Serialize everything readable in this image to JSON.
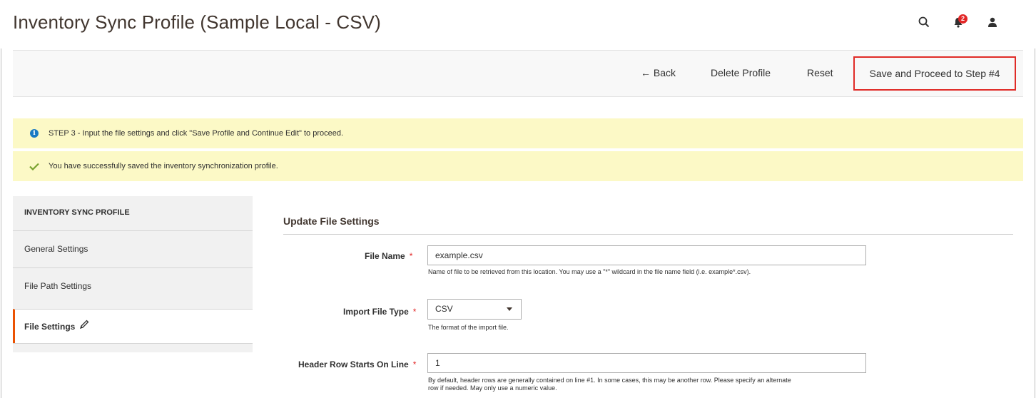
{
  "header": {
    "title": "Inventory Sync Profile (Sample Local - CSV)",
    "notification_count": "2"
  },
  "actions": {
    "back_label": "← Back",
    "delete_label": "Delete Profile",
    "reset_label": "Reset",
    "save_label": "Save and Proceed to Step #4"
  },
  "messages": {
    "info": "STEP 3 - Input the file settings and click \"Save Profile and Continue Edit\" to proceed.",
    "success": "You have successfully saved the inventory synchronization profile."
  },
  "sidebar": {
    "title": "INVENTORY SYNC PROFILE",
    "items": [
      {
        "label": "General Settings"
      },
      {
        "label": "File Path Settings"
      },
      {
        "label": "File Settings",
        "active": true
      }
    ]
  },
  "form": {
    "section_title": "Update File Settings",
    "file_name": {
      "label": "File Name",
      "value": "example.csv",
      "note": "Name of file to be retrieved from this location. You may use a \"*\" wildcard in the file name field (i.e. example*.csv)."
    },
    "import_file_type": {
      "label": "Import File Type",
      "value": "CSV",
      "note": "The format of the import file."
    },
    "header_row": {
      "label": "Header Row Starts On Line",
      "value": "1",
      "note_line1": "By default, header rows are generally contained on line #1. In some cases, this may be another row. Please specify an alternate",
      "note_line2": "row if needed. May only use a numeric value."
    },
    "required_mark": "*"
  },
  "colors": {
    "accent_orange": "#eb5202",
    "highlight_red": "#e02b27",
    "message_bg": "#fcf9c6",
    "info_blue": "#1979c3",
    "success_green": "#79a22e"
  },
  "icons": [
    "search-icon",
    "bell-icon",
    "user-icon",
    "info-icon",
    "checkmark-icon",
    "pencil-icon",
    "chevron-down-icon"
  ]
}
